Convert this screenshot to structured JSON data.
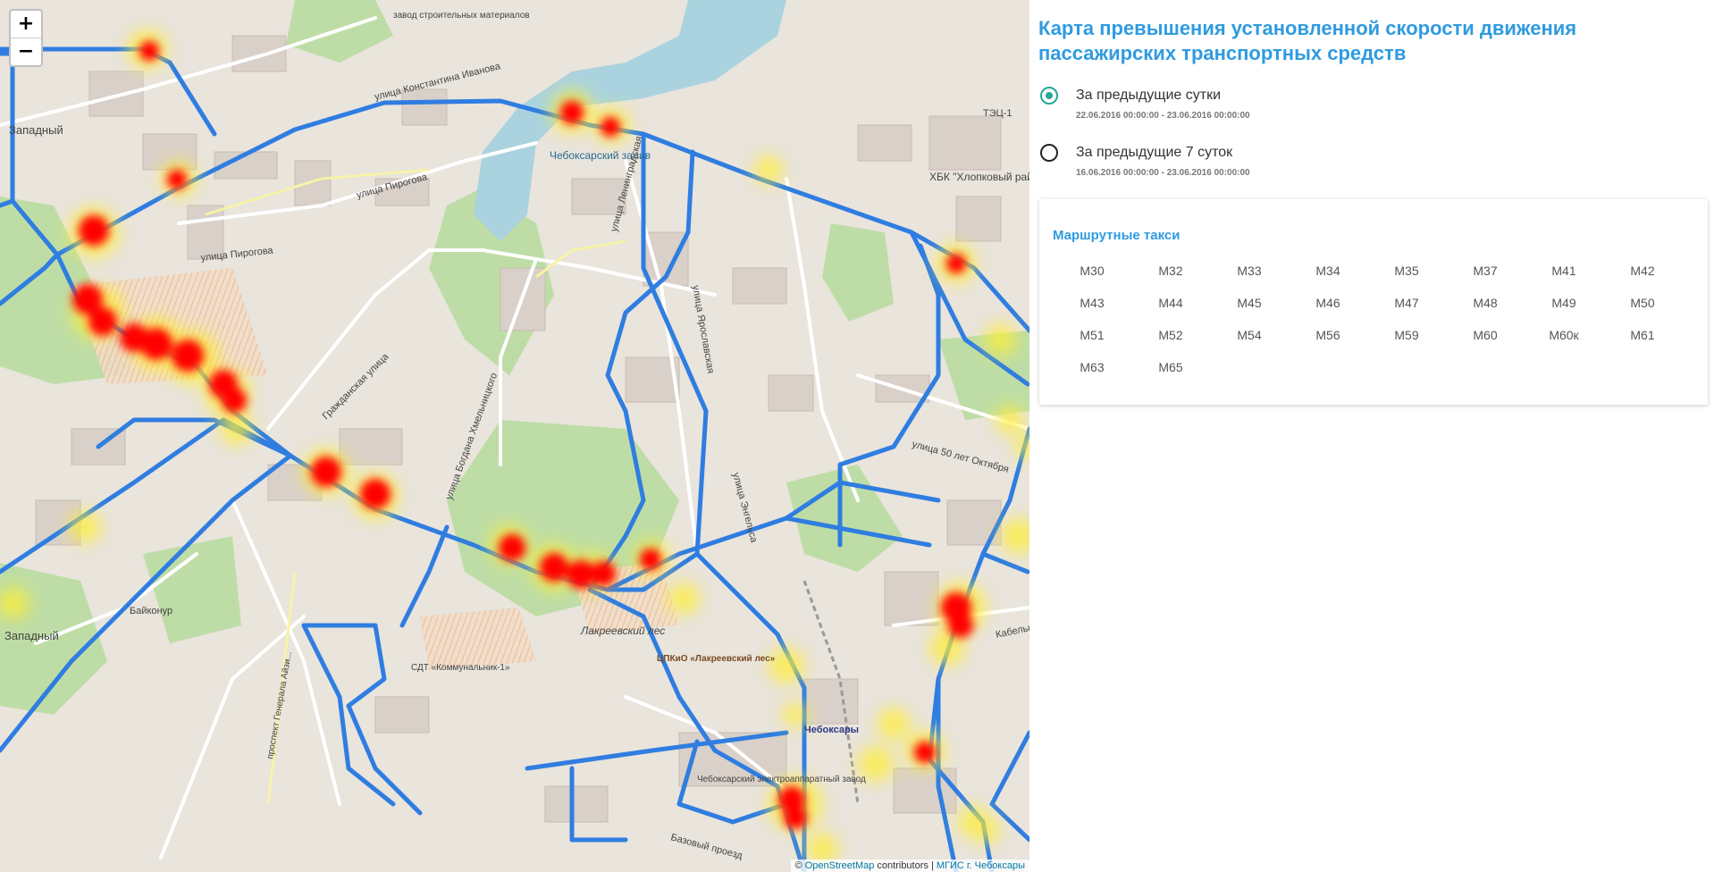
{
  "map": {
    "zoom_in": "+",
    "zoom_out": "−",
    "attribution": {
      "prefix": "©",
      "osm": "OpenStreetMap",
      "contrib": " contributors | ",
      "mgis": "МГИС г. Чебоксары"
    },
    "labels": [
      "улица Константина Иванова",
      "улица Пирогова",
      "улица Пирогова",
      "Чебоксарский залив",
      "улица Богдана Хмельницкого",
      "Гражданская улица",
      "Лакреевский лес",
      "ЦПКиО «Лакреевский лес»",
      "СДТ «Коммунальник-1»",
      "Байконур",
      "Западный",
      "Западный",
      "Чебоксары",
      "Чебоксарский электроаппаратный завод",
      "ХБК \"Хлопковый рай\"",
      "ТЭЦ-1",
      "улица 50 лет Октября",
      "улица Энгельса",
      "улица Ярославская",
      "Базовый проезд",
      "проспект Генерала Айзи...",
      "улица Ленинградская",
      "Кабельн...",
      "завод строительных материалов"
    ]
  },
  "panel": {
    "title": "Карта превышения установленной скорости движения пассажирских транспортных средств",
    "options": [
      {
        "label": "За предыдущие сутки",
        "range": "22.06.2016 00:00:00 - 23.06.2016 00:00:00",
        "selected": true
      },
      {
        "label": "За предыдущие 7 суток",
        "range": "16.06.2016 00:00:00 - 23.06.2016 00:00:00",
        "selected": false
      }
    ],
    "card_title": "Маршрутные такси",
    "routes": [
      "М30",
      "М32",
      "М33",
      "М34",
      "М35",
      "М37",
      "М41",
      "М42",
      "М43",
      "М44",
      "М45",
      "М46",
      "М47",
      "М48",
      "М49",
      "М50",
      "М51",
      "М52",
      "М54",
      "М56",
      "М59",
      "М60",
      "М60к",
      "М61",
      "М63",
      "М65"
    ]
  },
  "colors": {
    "accent": "#2f9be0",
    "radio_selected": "#26a69a",
    "route_line": "#2f7de1",
    "heat_hot": "#ff0000",
    "heat_warm": "#ffff00"
  }
}
